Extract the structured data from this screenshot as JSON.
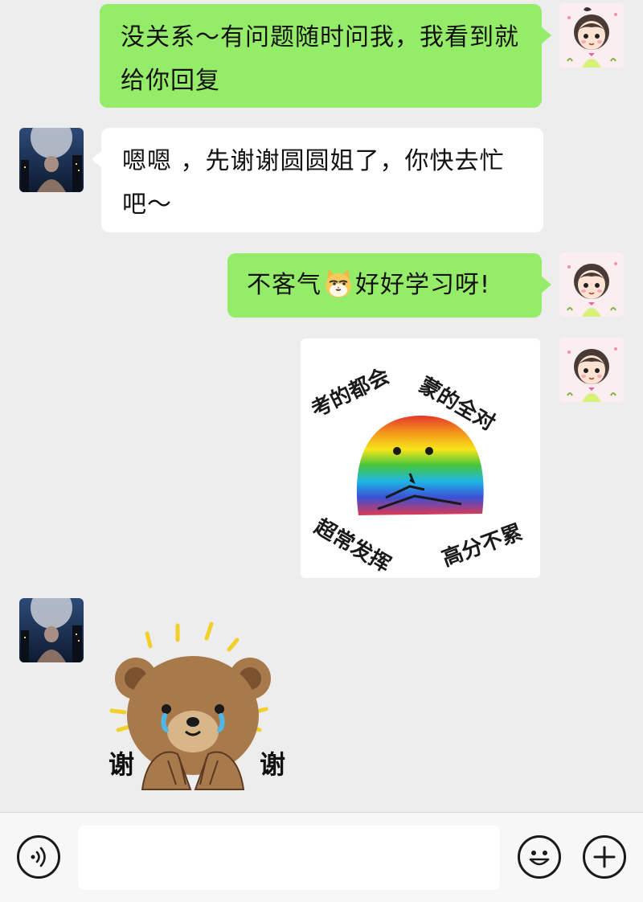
{
  "messages": [
    {
      "sender": "self",
      "type": "text",
      "text": "没关系～有问题随时问我，我看到就给你回复"
    },
    {
      "sender": "other",
      "type": "text",
      "text": "嗯嗯 ，先谢谢圆圆姐了，你快去忙吧～"
    },
    {
      "sender": "self",
      "type": "text",
      "text_before_emoji": "不客气",
      "emoji": "cat-face-icon",
      "text_after_emoji": "好好学习呀!"
    },
    {
      "sender": "self",
      "type": "sticker",
      "captions": [
        "考的都会",
        "蒙的全对",
        "超常发挥",
        "高分不累"
      ]
    },
    {
      "sender": "other",
      "type": "sticker",
      "captions": [
        "谢",
        "谢"
      ]
    }
  ],
  "input_bar": {
    "voice_icon": "voice-icon",
    "input_value": "",
    "emoji_icon": "emoji-icon",
    "plus_icon": "plus-icon"
  },
  "colors": {
    "background": "#ededed",
    "self_bubble": "#95ec69",
    "other_bubble": "#ffffff"
  }
}
